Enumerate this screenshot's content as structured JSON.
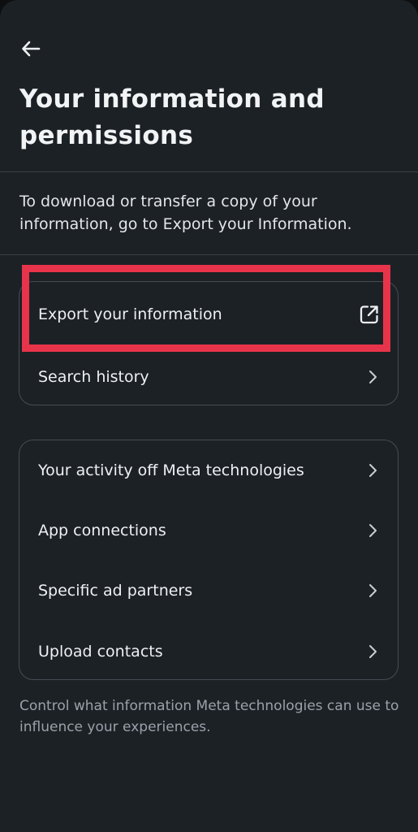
{
  "header": {
    "back_icon": "arrow-left-icon",
    "title": "Your information and permissions"
  },
  "intro_text": "To download or transfer a copy of your information, go to Export your Information.",
  "card1": {
    "items": [
      {
        "label": "Export your information",
        "icon": "external-link-icon"
      },
      {
        "label": "Search history",
        "icon": "chevron-right-icon"
      }
    ]
  },
  "card2": {
    "items": [
      {
        "label": "Your activity off Meta technologies",
        "icon": "chevron-right-icon"
      },
      {
        "label": "App connections",
        "icon": "chevron-right-icon"
      },
      {
        "label": "Specific ad partners",
        "icon": "chevron-right-icon"
      },
      {
        "label": "Upload contacts",
        "icon": "chevron-right-icon"
      }
    ]
  },
  "footnote": "Control what information Meta technologies can use to influence your experiences.",
  "colors": {
    "background": "#1c2126",
    "highlight": "#e8344a",
    "text": "#eef0f2",
    "secondary_text": "#9aa1a8"
  }
}
